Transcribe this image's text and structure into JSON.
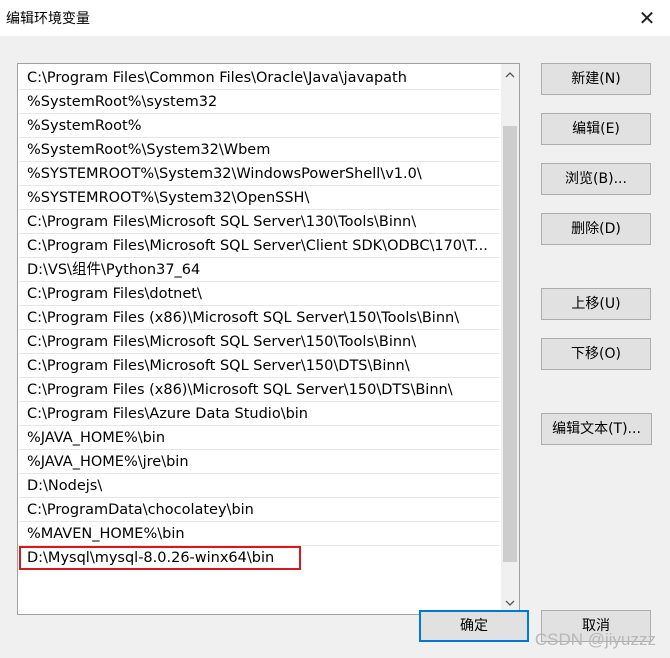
{
  "window": {
    "title": "编辑环境变量",
    "close_glyph": "✕"
  },
  "path_list": {
    "items": [
      "C:\\Program Files\\Common Files\\Oracle\\Java\\javapath",
      "%SystemRoot%\\system32",
      "%SystemRoot%",
      "%SystemRoot%\\System32\\Wbem",
      "%SYSTEMROOT%\\System32\\WindowsPowerShell\\v1.0\\",
      "%SYSTEMROOT%\\System32\\OpenSSH\\",
      "C:\\Program Files\\Microsoft SQL Server\\130\\Tools\\Binn\\",
      "C:\\Program Files\\Microsoft SQL Server\\Client SDK\\ODBC\\170\\T...",
      "D:\\VS\\组件\\Python37_64",
      "C:\\Program Files\\dotnet\\",
      "C:\\Program Files (x86)\\Microsoft SQL Server\\150\\Tools\\Binn\\",
      "C:\\Program Files\\Microsoft SQL Server\\150\\Tools\\Binn\\",
      "C:\\Program Files\\Microsoft SQL Server\\150\\DTS\\Binn\\",
      "C:\\Program Files (x86)\\Microsoft SQL Server\\150\\DTS\\Binn\\",
      "C:\\Program Files\\Azure Data Studio\\bin",
      "%JAVA_HOME%\\bin",
      "%JAVA_HOME%\\jre\\bin",
      "D:\\Nodejs\\",
      "C:\\ProgramData\\chocolatey\\bin",
      "%MAVEN_HOME%\\bin",
      "D:\\Mysql\\mysql-8.0.26-winx64\\bin"
    ],
    "highlighted_index": 20,
    "highlight_color": "#d9181e"
  },
  "buttons": {
    "new": "新建(N)",
    "edit": "编辑(E)",
    "browse": "浏览(B)...",
    "delete": "删除(D)",
    "move_up": "上移(U)",
    "move_down": "下移(O)",
    "edit_text": "编辑文本(T)...",
    "ok": "确定",
    "cancel": "取消"
  },
  "watermark": "CSDN @jiyuzzz",
  "colors": {
    "ok_border": "#0078d7",
    "dialog_bg": "#f0f0f0"
  }
}
